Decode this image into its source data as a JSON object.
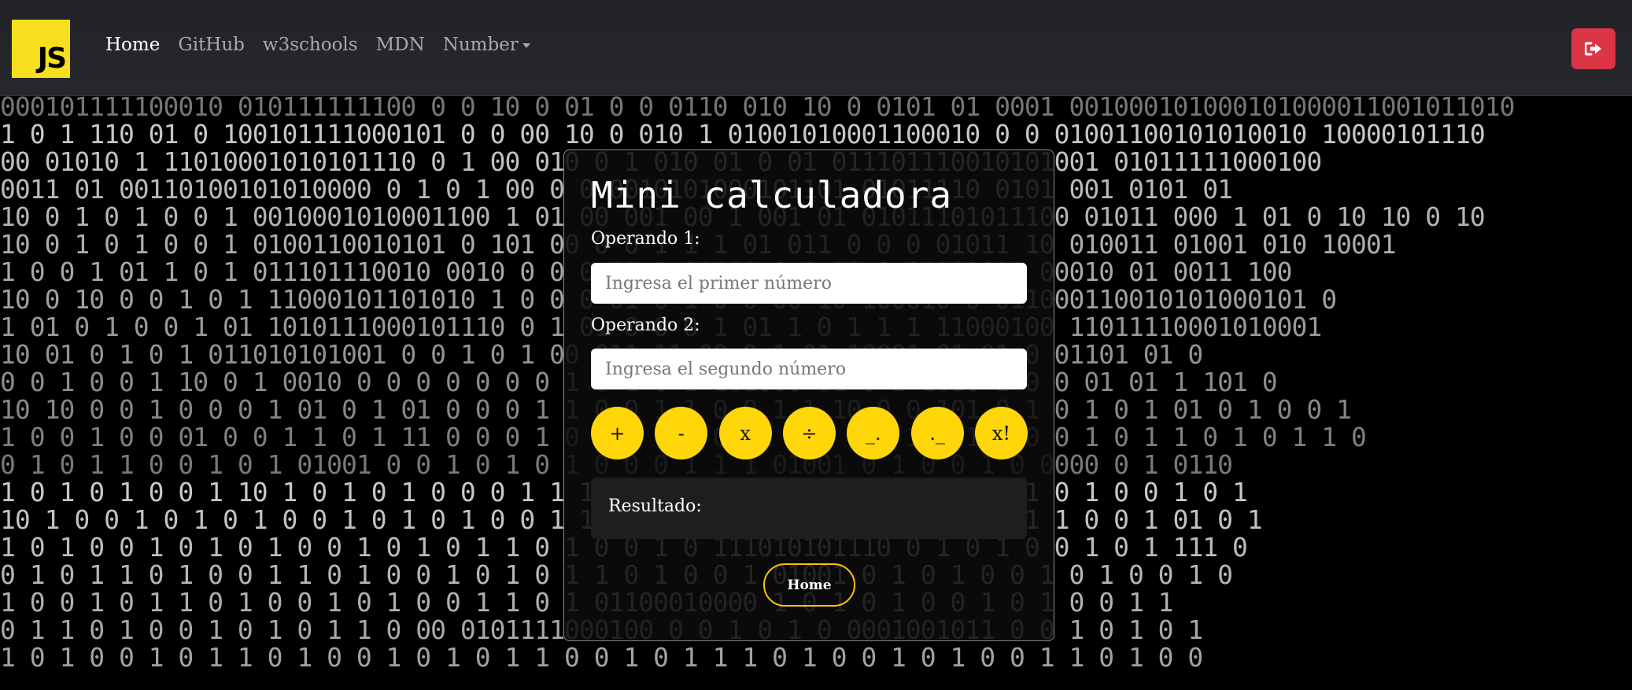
{
  "nav": {
    "logo_text": "JS",
    "links": [
      "Home",
      "GitHub",
      "w3schools",
      "MDN",
      "Number"
    ],
    "active": "Home"
  },
  "calculator": {
    "title": "Mini calculadora",
    "operand1_label": "Operando 1:",
    "operand1_placeholder": "Ingresa el primer número",
    "operand2_label": "Operando 2:",
    "operand2_placeholder": "Ingresa el segundo número",
    "operations": [
      "+",
      "-",
      "x",
      "÷",
      "_.",
      "._",
      "x!"
    ],
    "result_label": "Resultado:",
    "home_button": "Home"
  },
  "colors": {
    "accent": "#ffd60a",
    "logout": "#dc3545",
    "js_logo": "#f7df1e"
  },
  "background_rows": [
    "000101111100010 010111111100 0 0 10 0 01 0 0 0110 010 10 0 0101 01 0001 001000101000101000011001011010",
    "1 0 1 110 01 0 100101111000101 0 0 00 10 0 010 1 01001010001100010 0 0 01001100101010010 10000101110",
    "00 01010 1 11010001010101110 0 1 00 010 0 1 010 01 0 01 011101110010101001 01011111000100",
    "0011 01 00110100101010000 0 1 0 1 00 0 0 0010101000101101 01011110 0101 001 0101 01",
    "10 0 1 0 1 0 0 1 0010001010001100 1 01 00 001 00 1 001 01 01011101011100 01011 000 1 01 0 10 10 0 10",
    "10 0 1 0 1 0 0 1 0100110010101 0 101 00 0 0 1 1 1 01 011 0 0 0 01011 10 010011 01001 010 10001",
    "1 0 0 1 01 1 0 1 011101110010 0010 0 0 0 11 1 00100 1 1 10 0 01101011 00010 01 0011 100",
    "10 0 10 0 0 1 0 1 11000101101010 1 0 0 0 01 0 1 0 0 00 10 100010 0 011000110010101000101 0",
    "1 01 0 1 0 0 1 01 1010111000101110 0 1 01 0 0 0 1 01 1 0 1 1 1 11000100 11011110001010001",
    "10 01 0 1 0 1 011010101001 0 0 1 0 1 00 011 11 00 0 1 01 10001 01 01 0 01101 01 0",
    "0 0 1 0 0 1 10 0 1 0010 0 0 0 0 0 0 0 1 0 1 0 1 101000 01 0 1 1010 1 0 0 01 01 1 101 0",
    "10 10 0 0 1 0 0 0 1 01 0 1 01 0 0 0 1 1 0 0 1 1 0 0 1 1 10 0 0 101 0 1 0 1 0 1 01 0 1 0 0 1",
    "1 0 0 1 0 0 01 0 0 1 1 0 1 11 0 0 0 1 0 1 1 0 0 0 01 0 0 0 1 100 1 010 0 1 0 1 1 0 1 0 1 1 0",
    "0 1 0 1 1 0 0 1 0 1 01001 0 0 1 0 1 0 1 0 0 0 1 1 1 01001 0 1 0 0 1 0 0000 0 1 0110",
    "1 0 1 0 1 0 0 1 10 1 0 1 0 1 0 0 0 1 1 1 0 1 1 0 10100111011 1 0 1 0 1 0 1 0 0 1 0 1",
    "10 1 0 0 1 0 1 0 1 0 0 1 0 1 0 1 0 0 1 1 0 0 1 0 1 0 1 0 0 1 0 1 0 0 1 1 0 0 1 01 0 1",
    "1 0 1 0 0 1 0 1 0 1 0 0 1 0 1 0 1 1 0 1 0 0 1 0 111010101110 0 1 0 1 0 0 1 0 1 111 0",
    "0 1 0 1 1 0 1 0 0 1 1 0 1 0 0 1 0 1 0 1 1 0 1 0 0 1 01001 0 1 0 1 0 0 1 0 1 0 0 1 0",
    "1 0 0 1 0 1 1 0 1 0 0 1 0 1 0 0 1 1 0 1 01100010000 1 0 1 0 1 0 0 1 0 1 0 0 1 1",
    "0 1 1 0 1 0 0 1 0 1 0 1 1 0 00 0101111000100 0 0 1 0 1 0 0001001011 0 0 1 0 1 0 1",
    "1 0 1 0 0 1 0 1 1 0 1 0 0 1 0 1 0 1 1 0 0 1 0 1 1 1 0 1 0 0 1 0 1 0 0 1 1 0 1 0 0"
  ]
}
